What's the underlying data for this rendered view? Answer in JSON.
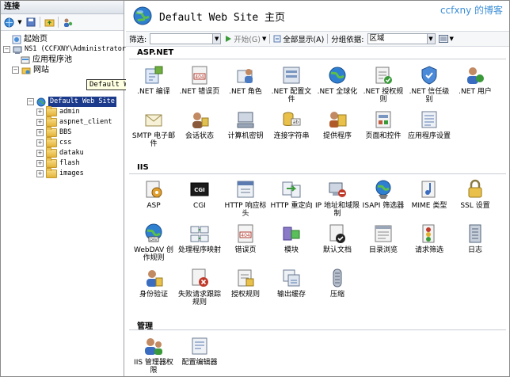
{
  "left_panel": {
    "title": "连接",
    "tree": {
      "start_page": "起始页",
      "server": "NS1 (CCFXNY\\Administrator)",
      "app_pools": "应用程序池",
      "sites": "网站",
      "site": "Default Web Site",
      "folders": [
        "admin",
        "aspnet_client",
        "BBS",
        "css",
        "dataku",
        "flash",
        "images"
      ]
    },
    "tooltip": "Default Web Site"
  },
  "header": {
    "title": "Default Web Site 主页",
    "watermark": "ccfxny 的博客"
  },
  "filter_bar": {
    "filter_label": "筛选:",
    "start_label": "开始(G)",
    "show_all_label": "全部显示(A)",
    "group_label": "分组依据:",
    "group_value": "区域"
  },
  "sections": [
    {
      "title": "ASP.NET",
      "features": [
        {
          "label": ".NET 编译",
          "icon": "compile-icon"
        },
        {
          "label": ".NET 错误页",
          "icon": "error-page-icon"
        },
        {
          "label": ".NET 角色",
          "icon": "roles-icon"
        },
        {
          "label": ".NET 配置文件",
          "icon": "profile-icon"
        },
        {
          "label": ".NET 全球化",
          "icon": "globe-icon"
        },
        {
          "label": ".NET 授权规则",
          "icon": "auth-rules-icon"
        },
        {
          "label": ".NET 信任级别",
          "icon": "trust-level-icon"
        },
        {
          "label": ".NET 用户",
          "icon": "users-icon"
        },
        {
          "label": "SMTP 电子邮件",
          "icon": "smtp-icon"
        },
        {
          "label": "会话状态",
          "icon": "session-icon"
        },
        {
          "label": "计算机密钥",
          "icon": "machine-key-icon"
        },
        {
          "label": "连接字符串",
          "icon": "connection-string-icon"
        },
        {
          "label": "提供程序",
          "icon": "providers-icon"
        },
        {
          "label": "页面和控件",
          "icon": "pages-controls-icon"
        },
        {
          "label": "应用程序设置",
          "icon": "app-settings-icon"
        }
      ]
    },
    {
      "title": "IIS",
      "features": [
        {
          "label": "ASP",
          "icon": "asp-icon"
        },
        {
          "label": "CGI",
          "icon": "cgi-icon"
        },
        {
          "label": "HTTP 响应标头",
          "icon": "http-headers-icon"
        },
        {
          "label": "HTTP 重定向",
          "icon": "http-redirect-icon"
        },
        {
          "label": "IP 地址和域限制",
          "icon": "ip-restrictions-icon"
        },
        {
          "label": "ISAPI 筛选器",
          "icon": "isapi-filters-icon"
        },
        {
          "label": "MIME 类型",
          "icon": "mime-types-icon"
        },
        {
          "label": "SSL 设置",
          "icon": "ssl-lock-icon"
        },
        {
          "label": "WebDAV 创作规则",
          "icon": "webdav-icon"
        },
        {
          "label": "处理程序映射",
          "icon": "handler-mappings-icon"
        },
        {
          "label": "错误页",
          "icon": "error-pages-icon"
        },
        {
          "label": "模块",
          "icon": "modules-icon"
        },
        {
          "label": "默认文档",
          "icon": "default-document-icon"
        },
        {
          "label": "目录浏览",
          "icon": "directory-browsing-icon"
        },
        {
          "label": "请求筛选",
          "icon": "request-filtering-icon"
        },
        {
          "label": "日志",
          "icon": "logging-icon"
        },
        {
          "label": "身份验证",
          "icon": "authentication-icon"
        },
        {
          "label": "失败请求跟踪规则",
          "icon": "failed-request-icon"
        },
        {
          "label": "授权规则",
          "icon": "authorization-icon"
        },
        {
          "label": "输出缓存",
          "icon": "output-cache-icon"
        },
        {
          "label": "压缩",
          "icon": "compression-icon"
        }
      ]
    },
    {
      "title": "管理",
      "features": [
        {
          "label": "IIS 管理器权限",
          "icon": "manager-permissions-icon"
        },
        {
          "label": "配置编辑器",
          "icon": "config-editor-icon"
        }
      ]
    }
  ]
}
